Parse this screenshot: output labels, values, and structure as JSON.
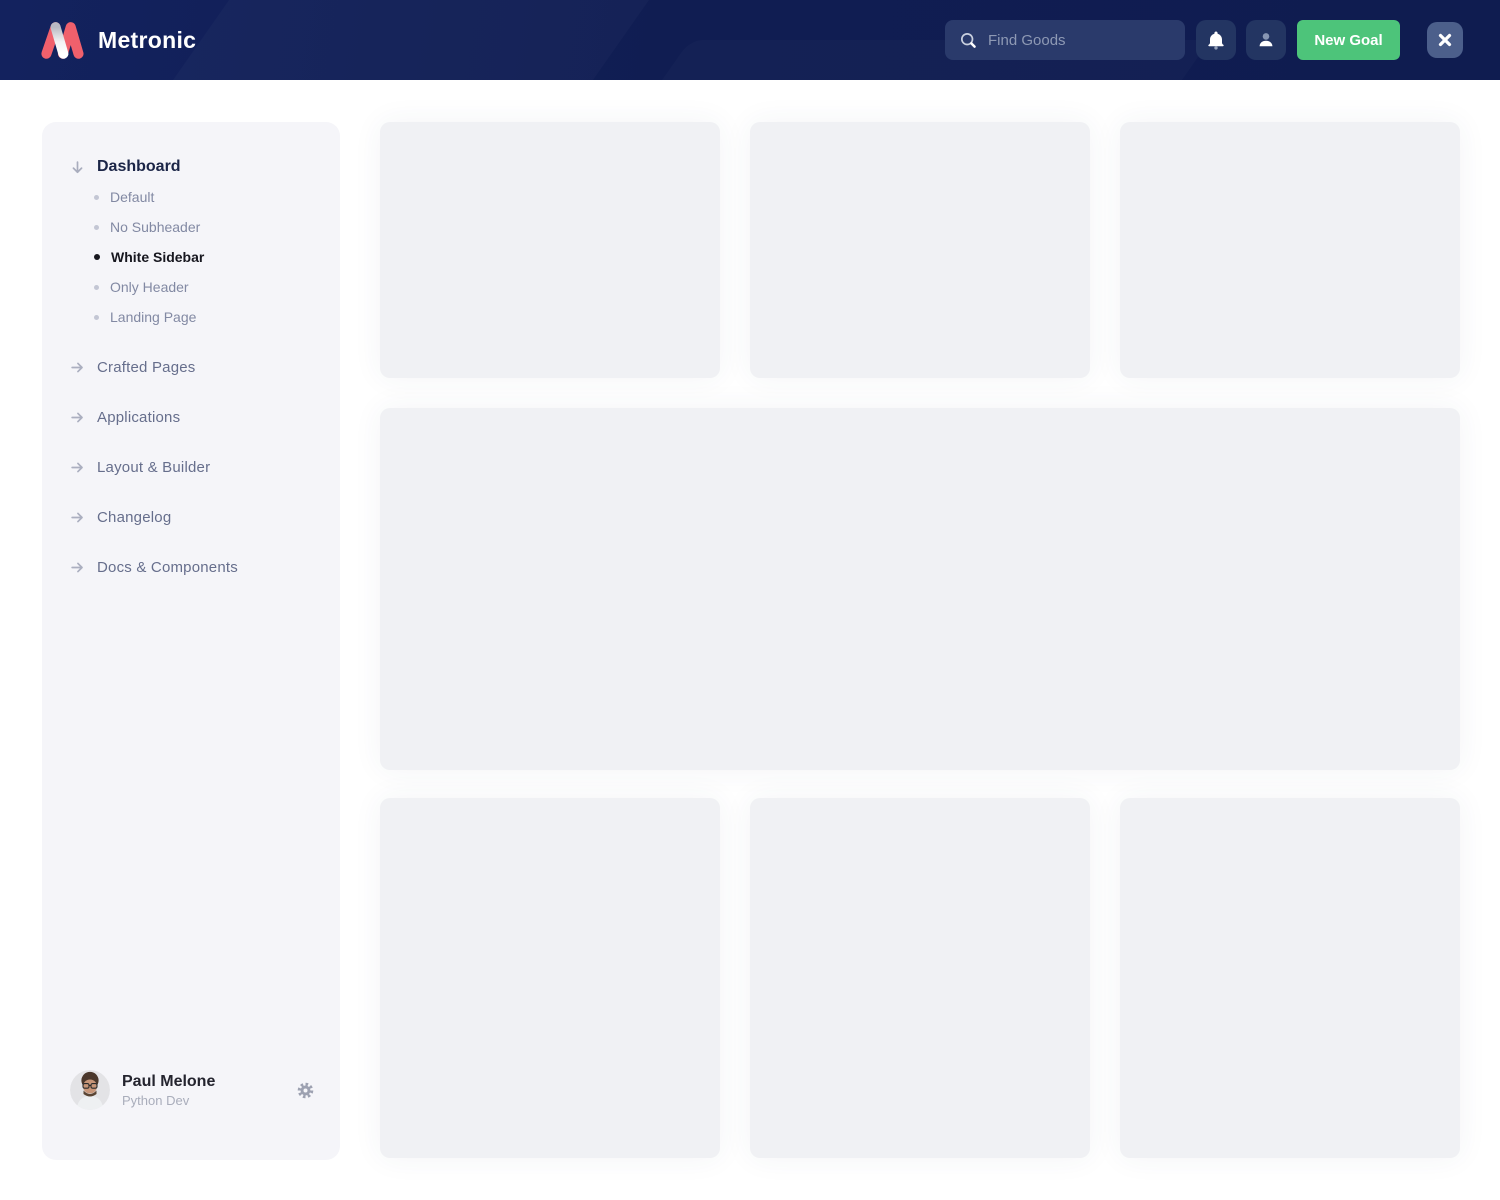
{
  "header": {
    "brand": "Metronic",
    "search_placeholder": "Find Goods",
    "new_goal_label": "New Goal",
    "icons": [
      "search-icon",
      "bell-icon",
      "user-icon",
      "close-icon"
    ]
  },
  "sidebar": {
    "root": {
      "label": "Dashboard",
      "icon": "arrow-down-icon",
      "expanded": true
    },
    "dashboard_children": [
      {
        "label": "Default",
        "active": false
      },
      {
        "label": "No Subheader",
        "active": false
      },
      {
        "label": "White Sidebar",
        "active": true
      },
      {
        "label": "Only Header",
        "active": false
      },
      {
        "label": "Landing Page",
        "active": false
      }
    ],
    "sections": [
      {
        "label": "Crafted Pages",
        "icon": "arrow-right-icon"
      },
      {
        "label": "Applications",
        "icon": "arrow-right-icon"
      },
      {
        "label": "Layout & Builder",
        "icon": "arrow-right-icon"
      },
      {
        "label": "Changelog",
        "icon": "arrow-right-icon"
      },
      {
        "label": "Docs & Components",
        "icon": "arrow-right-icon"
      }
    ],
    "user": {
      "name": "Paul Melone",
      "role": "Python Dev",
      "settings_icon": "gear-icon"
    }
  },
  "content": {
    "placeholder_cards": {
      "top_row": 3,
      "middle_row": 1,
      "bottom_row": 3
    }
  },
  "colors": {
    "header_bg": "#101d52",
    "brand_red": "#f0606c",
    "accent_green": "#4dc47a",
    "search_bg": "#2a3a6b",
    "icon_button_bg": "#233562",
    "close_button_bg": "#4c5f8b",
    "sidebar_bg": "#f5f5f9",
    "card_bg": "#f0f1f4",
    "active_text": "#17171f",
    "nav_root_text": "#1b2547"
  }
}
